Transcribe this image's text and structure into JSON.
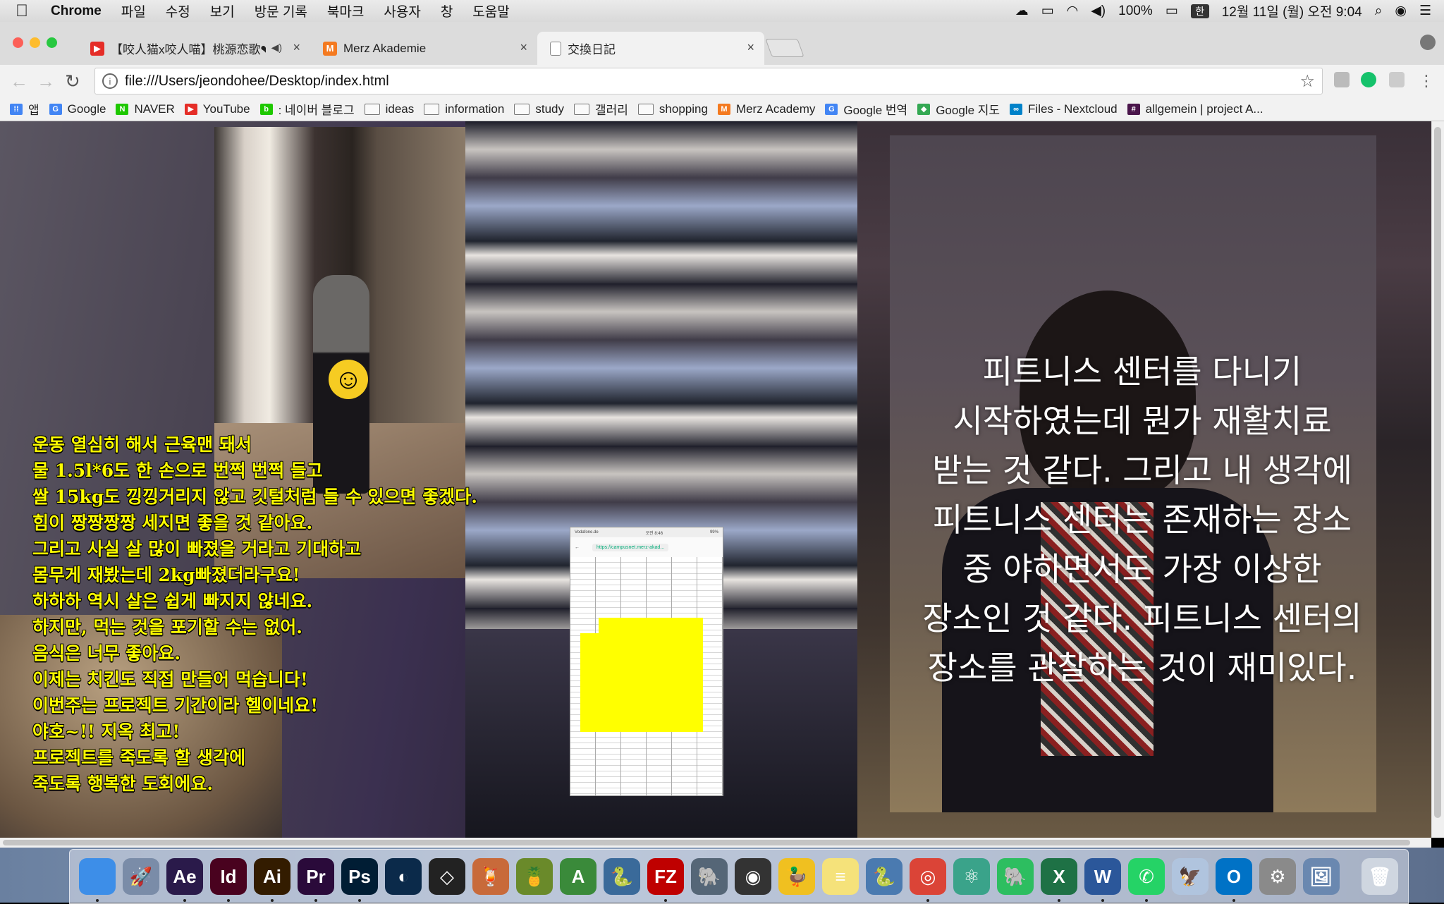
{
  "menubar": {
    "app": "Chrome",
    "menus": [
      "파일",
      "수정",
      "보기",
      "방문 기록",
      "북마크",
      "사용자",
      "창",
      "도움말"
    ],
    "battery": "100%",
    "input_method": "한",
    "clock": "12월 11일 (월) 오전 9:04"
  },
  "tabs": [
    {
      "title": "【咬人猫x咬人喵】桃源恋歌❤",
      "icon": "youtube-icon",
      "color": "#e52d27",
      "active": false
    },
    {
      "title": "Merz Akademie",
      "icon": "merz-icon",
      "color": "#f47a20",
      "active": false
    },
    {
      "title": "交換日記",
      "icon": "document-icon",
      "color": "#888888",
      "active": true
    }
  ],
  "address_bar": {
    "url": "file:///Users/jeondohee/Desktop/index.html"
  },
  "bookmarks": [
    {
      "label": "앱",
      "type": "apps",
      "color": "#4285f4"
    },
    {
      "label": "Google",
      "type": "site",
      "color": "#4285f4",
      "glyph": "G"
    },
    {
      "label": "NAVER",
      "type": "site",
      "color": "#1ec800",
      "glyph": "N"
    },
    {
      "label": "YouTube",
      "type": "site",
      "color": "#e52d27",
      "glyph": "▶"
    },
    {
      "label": ": 네이버 블로그",
      "type": "site",
      "color": "#1ec800",
      "glyph": "b"
    },
    {
      "label": "ideas",
      "type": "folder"
    },
    {
      "label": "information",
      "type": "folder"
    },
    {
      "label": "study",
      "type": "folder"
    },
    {
      "label": "갤러리",
      "type": "folder"
    },
    {
      "label": "shopping",
      "type": "folder"
    },
    {
      "label": "Merz Academy",
      "type": "site",
      "color": "#f47a20",
      "glyph": "M"
    },
    {
      "label": "Google 번역",
      "type": "site",
      "color": "#4285f4",
      "glyph": "G"
    },
    {
      "label": "Google 지도",
      "type": "site",
      "color": "#34a853",
      "glyph": "◆"
    },
    {
      "label": "Files - Nextcloud",
      "type": "site",
      "color": "#0082c9",
      "glyph": "∞"
    },
    {
      "label": "allgemein | project A...",
      "type": "site",
      "color": "#4a154b",
      "glyph": "#"
    }
  ],
  "page": {
    "yellow_lines": [
      "운동 열심히 해서 근육맨 돼서",
      "물 1.5l*6도 한 손으로 번쩍 번쩍 들고",
      "쌀 15kg도 낑낑거리지 않고 깃털처럼 들 수 있으면 좋겠다.",
      "힘이 짱짱짱짱 세지면 좋을 것 같아요.",
      "그리고 사실 살 많이 빠졌을 거라고 기대하고",
      "몸무게 재봤는데 2kg빠졌더라구요!",
      "하하하 역시 살은 쉽게 빠지지 않네요.",
      "하지만, 먹는 것을 포기할 수는 없어.",
      "음식은 너무 좋아요.",
      "이제는 치킨도 직접 만들어 먹습니다!",
      "이번주는 프로젝트 기간이라 헬이네요!",
      "야호~!! 지옥 최고!",
      "프로젝트를 죽도록 할 생각에",
      "죽도록 행복한 도회에요."
    ],
    "white_lines": [
      "피트니스 센터를 다니기",
      "시작하였는데 뭔가 재활치료",
      "받는 것 같다. 그리고 내 생각에",
      "피트니스 센터는 존재하는 장소",
      "중 야하면서도 가장 이상한",
      "장소인 것 같다. 피트니스 센터의",
      "장소를 관찰하는 것이 재미있다."
    ],
    "phone_url": "https://campusnet.merz-akad...",
    "phone_carrier": "Vodafone.de",
    "phone_time": "오전 8:46",
    "phone_battery": "99%"
  },
  "dock": [
    {
      "name": "finder-icon",
      "label": "",
      "color": "#3d8ee8"
    },
    {
      "name": "launchpad-icon",
      "label": "🚀",
      "color": "#7a8ca8"
    },
    {
      "name": "after-effects-icon",
      "label": "Ae",
      "color": "#2a1a4a"
    },
    {
      "name": "indesign-icon",
      "label": "Id",
      "color": "#49021f"
    },
    {
      "name": "illustrator-icon",
      "label": "Ai",
      "color": "#331c00"
    },
    {
      "name": "premiere-icon",
      "label": "Pr",
      "color": "#2a0a3a"
    },
    {
      "name": "photoshop-icon",
      "label": "Ps",
      "color": "#001d34"
    },
    {
      "name": "cinema4d-icon",
      "label": "◐",
      "color": "#0b2a4a"
    },
    {
      "name": "unity-icon",
      "label": "◇",
      "color": "#222222"
    },
    {
      "name": "cocktail-icon",
      "label": "🍹",
      "color": "#c86a3a"
    },
    {
      "name": "pineapple-icon",
      "label": "🍍",
      "color": "#6a8a2a"
    },
    {
      "name": "android-studio-icon",
      "label": "A",
      "color": "#3a8a3a"
    },
    {
      "name": "python-icon",
      "label": "🐍",
      "color": "#3a6a9a"
    },
    {
      "name": "filezilla-icon",
      "label": "FZ",
      "color": "#bf0000"
    },
    {
      "name": "sequel-pro-icon",
      "label": "🐘",
      "color": "#556677"
    },
    {
      "name": "github-icon",
      "label": "◉",
      "color": "#333333"
    },
    {
      "name": "cyberduck-icon",
      "label": "🦆",
      "color": "#f0c020"
    },
    {
      "name": "notes-icon",
      "label": "≡",
      "color": "#f5e27a"
    },
    {
      "name": "python-launcher-icon",
      "label": "🐍",
      "color": "#4a7ab0"
    },
    {
      "name": "chrome-icon",
      "label": "◎",
      "color": "#db4437"
    },
    {
      "name": "atom-icon",
      "label": "⚛",
      "color": "#3aa38a"
    },
    {
      "name": "evernote-icon",
      "label": "🐘",
      "color": "#2dbe60"
    },
    {
      "name": "excel-icon",
      "label": "X",
      "color": "#1e7145"
    },
    {
      "name": "word-icon",
      "label": "W",
      "color": "#2b579a"
    },
    {
      "name": "whatsapp-icon",
      "label": "✆",
      "color": "#25d366"
    },
    {
      "name": "preview-icon",
      "label": "🦅",
      "color": "#b0c4de"
    },
    {
      "name": "outlook-icon",
      "label": "O",
      "color": "#0072c6"
    },
    {
      "name": "system-preferences-icon",
      "label": "⚙",
      "color": "#8a8a8a"
    },
    {
      "name": "photo-viewer-icon",
      "label": "🖼",
      "color": "#6a88b0"
    },
    {
      "name": "trash-icon",
      "label": "🗑",
      "color": "#cfd6e0"
    }
  ]
}
